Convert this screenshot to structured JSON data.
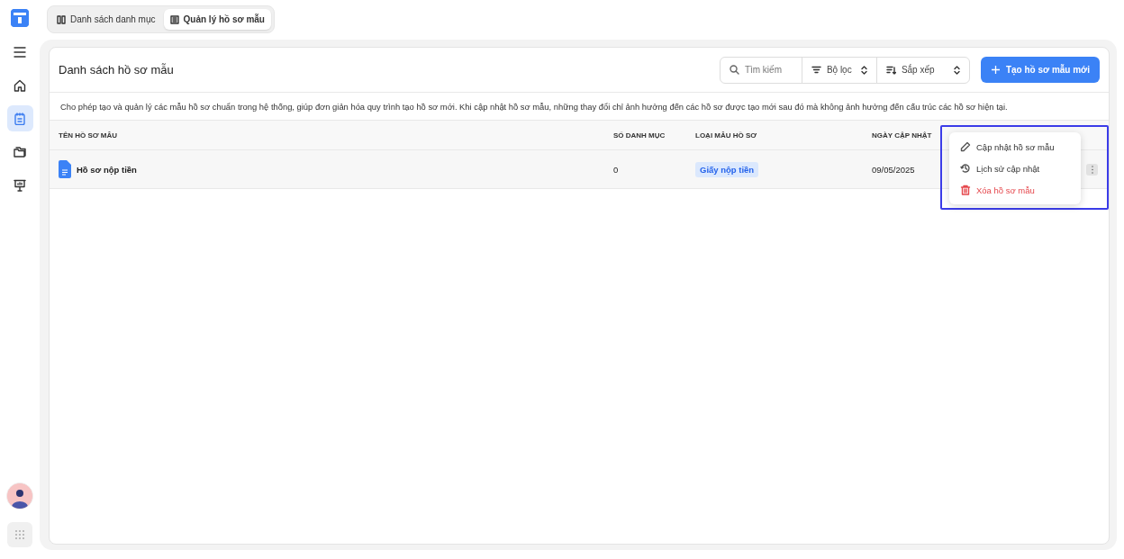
{
  "sidebar": {
    "items": [
      {
        "kind": "menu",
        "selected": false
      },
      {
        "kind": "home",
        "selected": false
      },
      {
        "kind": "calendar",
        "selected": true
      },
      {
        "kind": "folder",
        "selected": false
      },
      {
        "kind": "board",
        "selected": false
      }
    ]
  },
  "tabs": [
    {
      "label": "Danh sách danh mục",
      "kind": "book",
      "selected": false
    },
    {
      "label": "Quản lý hồ sơ mẫu",
      "kind": "list",
      "selected": true
    }
  ],
  "card": {
    "title": "Danh sách hồ sơ mẫu",
    "search": {
      "placeholder": "Tìm kiếm"
    },
    "filter": "Bộ lọc",
    "sort": "Sắp xếp",
    "create_button": "Tạo hồ sơ mẫu mới",
    "description": "Cho phép tạo và quản lý các mẫu hồ sơ chuẩn trong hệ thống, giúp đơn giản hóa quy trình tạo hồ sơ mới. Khi cập nhật hồ sơ mẫu, những thay đổi chỉ ảnh hưởng đến các hồ sơ được tạo mới sau đó mà không ảnh hưởng đến cấu trúc các hồ sơ hiện tại."
  },
  "table": {
    "columns": [
      "TÊN HỒ SƠ MẪU",
      "SỐ DANH MỤC",
      "LOẠI MẪU HỒ SƠ",
      "NGÀY CẬP NHẬT"
    ],
    "rows": [
      {
        "name": "Hồ sơ nộp tiền",
        "count": "0",
        "type": "Giấy nộp tiền",
        "date": "09/05/2025"
      }
    ]
  },
  "context_menu": {
    "items": [
      {
        "label": "Cập nhật hồ sơ mẫu",
        "kind": "edit"
      },
      {
        "label": "Lịch sử cập nhật",
        "kind": "history"
      },
      {
        "label": "Xóa hồ sơ mẫu",
        "kind": "delete"
      }
    ]
  }
}
